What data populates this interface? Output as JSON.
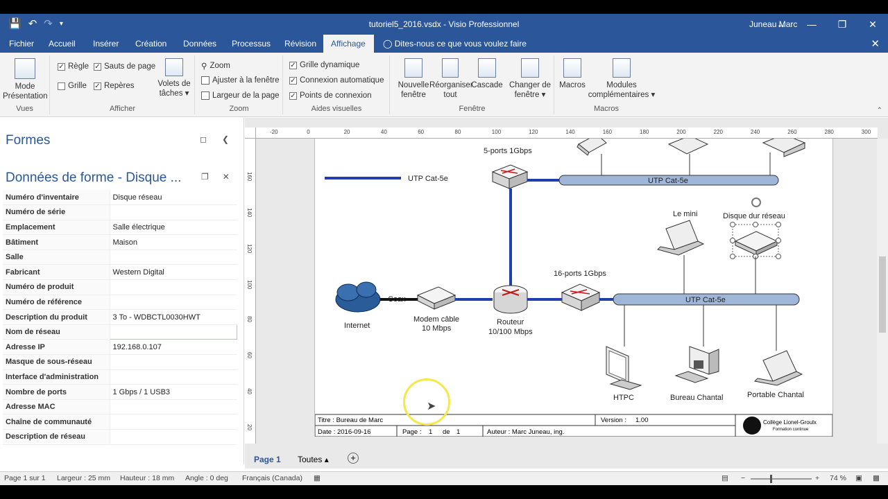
{
  "titlebar": {
    "title": "tutoriel5_2016.vsdx - Visio Professionnel",
    "user": "Juneau Marc"
  },
  "tabs": [
    {
      "label": "Fichier"
    },
    {
      "label": "Accueil"
    },
    {
      "label": "Insérer"
    },
    {
      "label": "Création"
    },
    {
      "label": "Données"
    },
    {
      "label": "Processus"
    },
    {
      "label": "Révision"
    },
    {
      "label": "Affichage"
    }
  ],
  "tellme": "Dites-nous ce que vous voulez faire",
  "ribbon": {
    "vues": {
      "label": "Vues",
      "mode": "Mode",
      "mode2": "Présentation"
    },
    "afficher": {
      "label": "Afficher",
      "regle": "Règle",
      "grille": "Grille",
      "sauts": "Sauts de page",
      "reperes": "Repères",
      "volets": "Volets de",
      "volets2": "tâches"
    },
    "zoom": {
      "label": "Zoom",
      "zoom": "Zoom",
      "ajuster": "Ajuster à la fenêtre",
      "largeur": "Largeur de la page"
    },
    "aides": {
      "label": "Aides visuelles",
      "grille_dyn": "Grille dynamique",
      "connexion": "Connexion automatique",
      "points": "Points de connexion"
    },
    "fenetre": {
      "label": "Fenêtre",
      "nouvelle": "Nouvelle",
      "nouvelle2": "fenêtre",
      "reorg": "Réorganiser",
      "reorg2": "tout",
      "cascade": "Cascade",
      "changer": "Changer de",
      "changer2": "fenêtre"
    },
    "macros": {
      "label": "Macros",
      "macros": "Macros",
      "modules": "Modules",
      "modules2": "complémentaires"
    }
  },
  "panel": {
    "formes": "Formes",
    "shape_data_title": "Données de forme - Disque ...",
    "rows": [
      {
        "k": "Numéro d'inventaire",
        "v": "Disque réseau"
      },
      {
        "k": "Numéro de série",
        "v": ""
      },
      {
        "k": "Emplacement",
        "v": "Salle électrique"
      },
      {
        "k": "Bâtiment",
        "v": "Maison"
      },
      {
        "k": "Salle",
        "v": ""
      },
      {
        "k": "Fabricant",
        "v": "Western Digital"
      },
      {
        "k": "Numéro de produit",
        "v": ""
      },
      {
        "k": "Numéro de référence",
        "v": ""
      },
      {
        "k": "Description du produit",
        "v": "3 To  - WDBCTL0030HWT"
      },
      {
        "k": "Nom de réseau",
        "v": ""
      },
      {
        "k": "Adresse IP",
        "v": "192.168.0.107"
      },
      {
        "k": "Masque de sous-réseau",
        "v": ""
      },
      {
        "k": "Interface d'administration",
        "v": ""
      },
      {
        "k": "Nombre de ports",
        "v": "1 Gbps / 1 USB3"
      },
      {
        "k": "Adresse MAC",
        "v": ""
      },
      {
        "k": "Chaîne de communauté",
        "v": ""
      },
      {
        "k": "Description de réseau",
        "v": ""
      }
    ]
  },
  "ruler": {
    "h": [
      "-20",
      "0",
      "20",
      "40",
      "60",
      "80",
      "100",
      "120",
      "140",
      "160",
      "180",
      "200",
      "220",
      "240",
      "260",
      "280",
      "300"
    ],
    "v": [
      "160",
      "140",
      "120",
      "100",
      "80",
      "60",
      "40",
      "20"
    ]
  },
  "diagram": {
    "legend_cable": "UTP Cat-5e",
    "switch5": "5-ports 1Gbps",
    "bus_top": "UTP Cat-5e",
    "lemini": "Le mini",
    "nas": "Disque dur réseau",
    "switch16": "16-ports 1Gbps",
    "bus_mid": "UTP Cat-5e",
    "coax": "Coax",
    "internet": "Internet",
    "modem1": "Modem câble",
    "modem2": "10 Mbps",
    "routeur1": "Routeur",
    "routeur2": "10/100 Mbps",
    "htpc": "HTPC",
    "bureau": "Bureau Chantal",
    "portable": "Portable Chantal",
    "titleblock": {
      "titre": "Titre :  Bureau de Marc",
      "version_l": "Version :",
      "version_v": "1.00",
      "date": "Date :  2016-09-16",
      "page_l": "Page :",
      "page_n": "1",
      "page_de": "de",
      "page_t": "1",
      "auteur": "Auteur : Marc Juneau, ing.",
      "college": "Collège Lionel-Groulx",
      "formation": "Formation continue"
    }
  },
  "pagetabs": {
    "page1": "Page 1",
    "toutes": "Toutes"
  },
  "status": {
    "page": "Page 1 sur 1",
    "largeur": "Largeur : 25 mm",
    "hauteur": "Hauteur : 18 mm",
    "angle": "Angle : 0 deg",
    "langue": "Français (Canada)",
    "zoom": "74 %"
  },
  "colors": {
    "brand": "#2b579a",
    "cable": "#1f3fae"
  }
}
